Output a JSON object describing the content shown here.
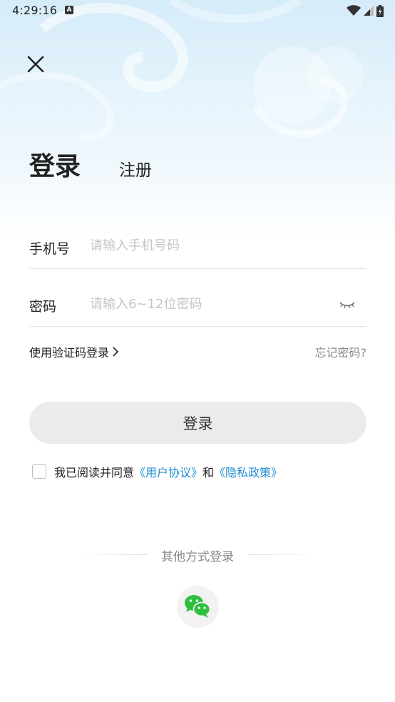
{
  "status_bar": {
    "time": "4:29:16",
    "notification_icon": "a-notification-icon",
    "icons": [
      "wifi-icon",
      "signal-icon",
      "battery-icon"
    ]
  },
  "close_icon": "close-icon",
  "tabs": {
    "login": "登录",
    "register": "注册"
  },
  "form": {
    "phone_label": "手机号",
    "phone_placeholder": "请输入手机号码",
    "phone_value": "",
    "password_label": "密码",
    "password_placeholder": "请输入6~12位密码",
    "password_value": "",
    "password_toggle_icon": "eye-closed-icon"
  },
  "sms_login_link": "使用验证码登录",
  "forgot_password": "忘记密码?",
  "login_button": "登录",
  "agreement": {
    "checked": false,
    "prefix": "我已阅读并同意",
    "user_agreement": "《用户协议》",
    "conjunction": "和",
    "privacy_policy": "《隐私政策》"
  },
  "other_login": {
    "title": "其他方式登录",
    "methods": [
      "wechat-icon"
    ]
  },
  "colors": {
    "link": "#1f8fd3",
    "button_bg": "#ebebeb",
    "wechat_green": "#2fbf3f",
    "header_bg": "#d5ecf9"
  }
}
